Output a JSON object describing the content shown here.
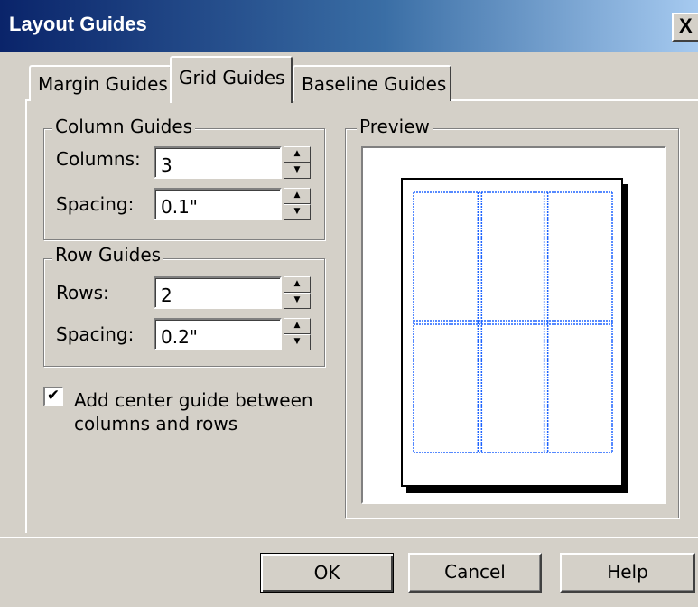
{
  "window": {
    "title": "Layout Guides",
    "close_label": "X"
  },
  "tabs": [
    {
      "label": "Margin Guides",
      "active": false
    },
    {
      "label": "Grid Guides",
      "active": true
    },
    {
      "label": "Baseline Guides",
      "active": false
    }
  ],
  "column_guides": {
    "legend": "Column Guides",
    "columns_label": "Columns:",
    "columns_value": "3",
    "spacing_label": "Spacing:",
    "spacing_value": "0.1\""
  },
  "row_guides": {
    "legend": "Row Guides",
    "rows_label": "Rows:",
    "rows_value": "2",
    "spacing_label": "Spacing:",
    "spacing_value": "0.2\""
  },
  "center_guide": {
    "label": "Add center guide between columns and rows",
    "checked": true
  },
  "preview": {
    "legend": "Preview",
    "grid_color": "#1e64ff",
    "columns": 3,
    "rows": 2
  },
  "buttons": {
    "ok": "OK",
    "cancel": "Cancel",
    "help": "Help"
  },
  "icons": {
    "spin_up": "spin-up-arrow-icon",
    "spin_down": "spin-down-arrow-icon",
    "check": "checkmark-icon"
  }
}
